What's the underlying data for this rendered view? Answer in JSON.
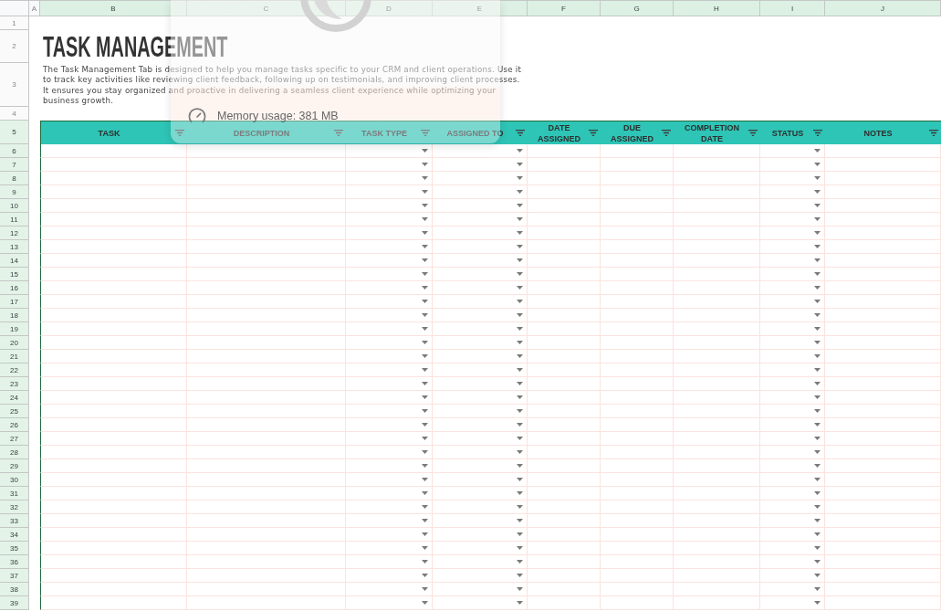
{
  "sheet": {
    "column_headers": [
      {
        "label": "A",
        "selected": false
      },
      {
        "label": "B",
        "selected": true
      },
      {
        "label": "C",
        "selected": true
      },
      {
        "label": "D",
        "selected": true
      },
      {
        "label": "E",
        "selected": true
      },
      {
        "label": "F",
        "selected": true
      },
      {
        "label": "G",
        "selected": true
      },
      {
        "label": "H",
        "selected": true
      },
      {
        "label": "I",
        "selected": true
      },
      {
        "label": "J",
        "selected": true
      }
    ],
    "row_headers": [
      {
        "label": "1",
        "selected": false
      },
      {
        "label": "2",
        "selected": false
      },
      {
        "label": "3",
        "selected": false
      },
      {
        "label": "4",
        "selected": false
      },
      {
        "label": "5",
        "selected": true
      },
      {
        "label": "6",
        "selected": true
      },
      {
        "label": "7",
        "selected": true
      },
      {
        "label": "8",
        "selected": true
      },
      {
        "label": "9",
        "selected": true
      },
      {
        "label": "10",
        "selected": true
      },
      {
        "label": "11",
        "selected": true
      },
      {
        "label": "12",
        "selected": true
      },
      {
        "label": "13",
        "selected": true
      },
      {
        "label": "14",
        "selected": true
      },
      {
        "label": "15",
        "selected": true
      },
      {
        "label": "16",
        "selected": true
      },
      {
        "label": "17",
        "selected": true
      },
      {
        "label": "18",
        "selected": true
      },
      {
        "label": "19",
        "selected": true
      },
      {
        "label": "20",
        "selected": true
      },
      {
        "label": "21",
        "selected": true
      },
      {
        "label": "22",
        "selected": true
      },
      {
        "label": "23",
        "selected": true
      },
      {
        "label": "24",
        "selected": true
      },
      {
        "label": "25",
        "selected": true
      },
      {
        "label": "26",
        "selected": true
      },
      {
        "label": "27",
        "selected": true
      },
      {
        "label": "28",
        "selected": true
      },
      {
        "label": "29",
        "selected": true
      },
      {
        "label": "30",
        "selected": true
      },
      {
        "label": "31",
        "selected": true
      },
      {
        "label": "32",
        "selected": true
      },
      {
        "label": "33",
        "selected": true
      },
      {
        "label": "34",
        "selected": true
      },
      {
        "label": "35",
        "selected": true
      },
      {
        "label": "36",
        "selected": true
      },
      {
        "label": "37",
        "selected": true
      },
      {
        "label": "38",
        "selected": true
      },
      {
        "label": "39",
        "selected": true
      }
    ]
  },
  "title": "TASK MANAGEMENT",
  "description": "The Task Management Tab is designed to help you manage tasks specific to your CRM and client operations. Use it to track key activities like reviewing client feedback, following up on testimonials, and improving client processes. It ensures you stay organized and proactive in delivering a seamless client experience while optimizing your business growth.",
  "table": {
    "columns": [
      {
        "label": "TASK",
        "kind": "text"
      },
      {
        "label": "DESCRIPTION",
        "kind": "text"
      },
      {
        "label": "TASK TYPE",
        "kind": "dropdown"
      },
      {
        "label": "ASSIGNED TO",
        "kind": "dropdown"
      },
      {
        "label": "DATE ASSIGNED",
        "kind": "text"
      },
      {
        "label": "DUE ASSIGNED",
        "kind": "text"
      },
      {
        "label": "COMPLETION DATE",
        "kind": "text"
      },
      {
        "label": "STATUS",
        "kind": "dropdown"
      },
      {
        "label": "NOTES",
        "kind": "text"
      }
    ]
  },
  "memory_popup": {
    "text": "Memory usage: 381 MB"
  }
}
